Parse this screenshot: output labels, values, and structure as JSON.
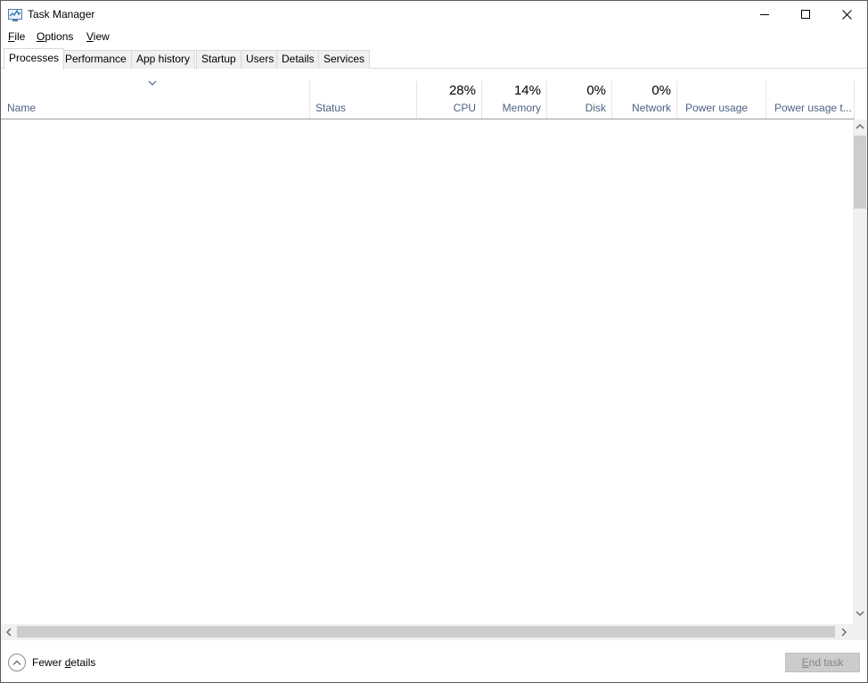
{
  "window": {
    "title": "Task Manager",
    "icon": "task-manager-icon"
  },
  "menu": {
    "file": {
      "first": "F",
      "rest": "ile"
    },
    "options": {
      "first": "O",
      "rest": "ptions"
    },
    "view": {
      "first": "V",
      "rest": "iew"
    }
  },
  "tabs": [
    {
      "label": "Processes",
      "active": true
    },
    {
      "label": "Performance"
    },
    {
      "label": "App history"
    },
    {
      "label": "Startup"
    },
    {
      "label": "Users"
    },
    {
      "label": "Details"
    },
    {
      "label": "Services"
    }
  ],
  "columns": {
    "name": {
      "label": "Name"
    },
    "status": {
      "label": "Status"
    },
    "cpu": {
      "label": "CPU",
      "value": "28%"
    },
    "memory": {
      "label": "Memory",
      "value": "14%"
    },
    "disk": {
      "label": "Disk",
      "value": "0%"
    },
    "network": {
      "label": "Network",
      "value": "0%"
    },
    "power": {
      "label": "Power usage"
    },
    "power_trend": {
      "label": "Power usage t..."
    }
  },
  "footer": {
    "fewer_details": {
      "first": "Fewer ",
      "underline": "d",
      "rest": "etails"
    },
    "end_task": {
      "underline": "E",
      "rest": "nd task"
    }
  },
  "colors": {
    "header_label": "#4d6082",
    "disabled_button": "#cccccc"
  }
}
